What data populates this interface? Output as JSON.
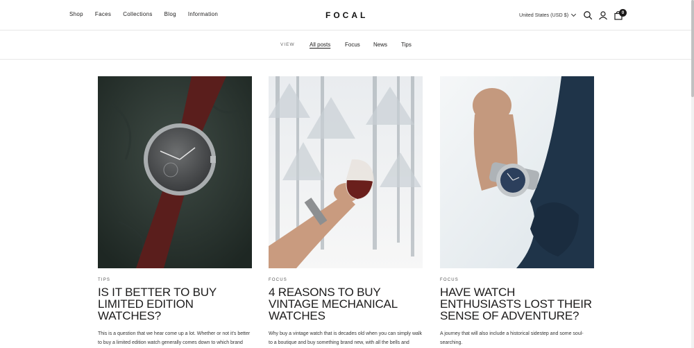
{
  "nav": {
    "items": [
      "Shop",
      "Faces",
      "Collections",
      "Blog",
      "Information"
    ]
  },
  "brand": {
    "logo": "FOCAL"
  },
  "header": {
    "currency": "United States (USD $)",
    "cart_count": "0"
  },
  "filter": {
    "label": "VIEW",
    "tabs": [
      "All posts",
      "Focus",
      "News",
      "Tips"
    ],
    "active": "All posts"
  },
  "posts": [
    {
      "category": "TIPS",
      "title": "Is it better to buy limited edition watches?",
      "excerpt": "This is a question that we hear come up a lot. Whether or not it's better to buy a limited edition watch generally comes down to which brand and which model is on offer."
    },
    {
      "category": "FOCUS",
      "title": "4 reasons to buy vintage mechanical watches",
      "excerpt": "Why buy a vintage watch that is decades old when you can simply walk to a boutique and buy something brand new, with all the bells and whistles? Here are four reasons."
    },
    {
      "category": "FOCUS",
      "title": "Have watch enthusiasts lost their sense of adventure?",
      "excerpt": "A journey that will also include a historical sidestep and some soul-searching."
    }
  ],
  "icons": {
    "search": "search-icon",
    "account": "user-icon",
    "cart": "bag-icon",
    "currency_dropdown": "chevron-down-icon"
  }
}
